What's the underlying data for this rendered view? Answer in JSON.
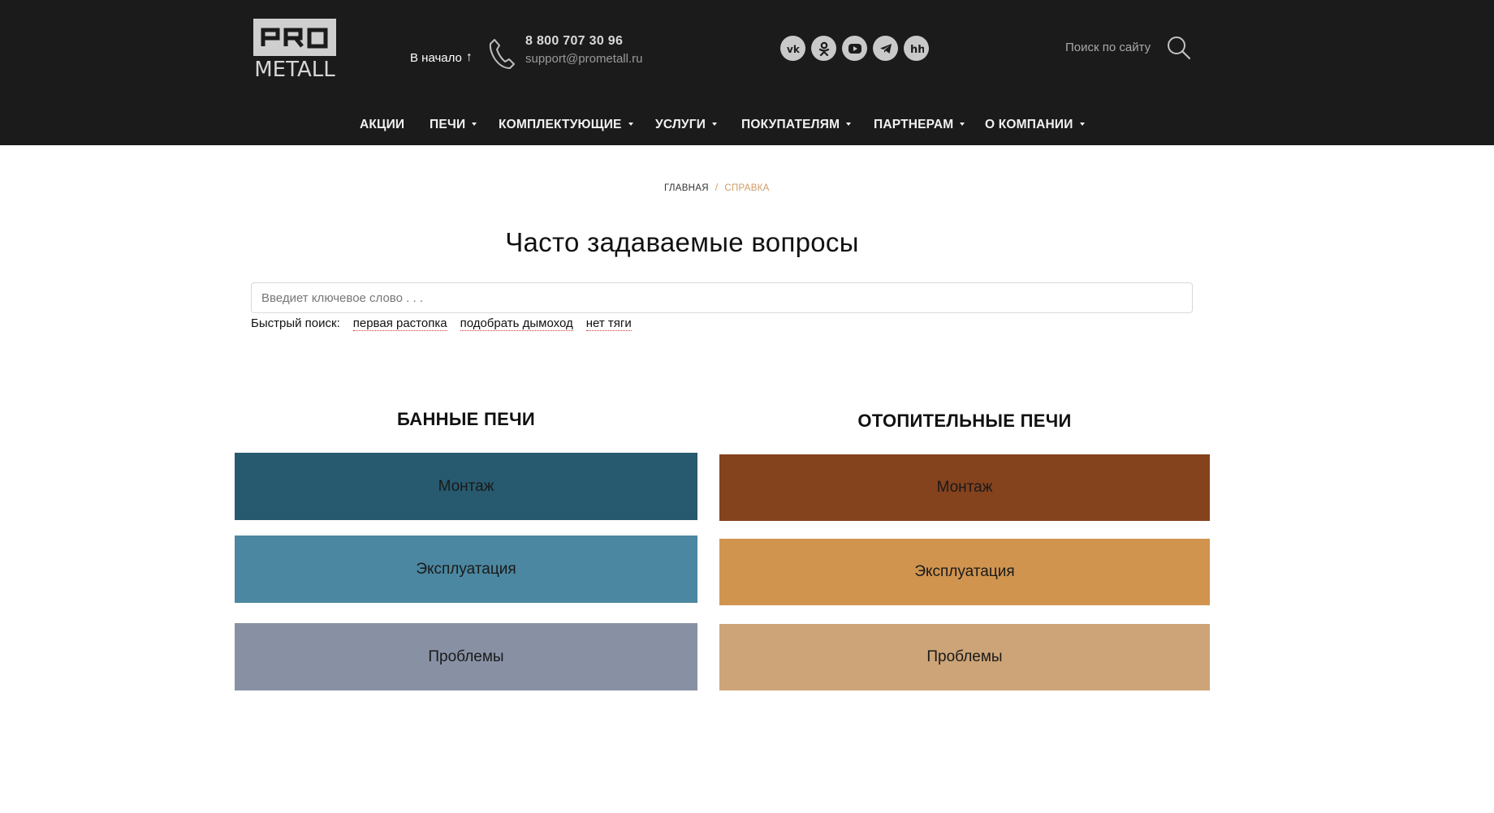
{
  "header": {
    "logo_text": "PRO METALL",
    "logo_bottom": "METALL",
    "to_top_label": "В начало",
    "phone": "8 800 707 30 96",
    "email": "support@prometall.ru",
    "socials": [
      "vk",
      "ok",
      "youtube",
      "telegram",
      "hh"
    ],
    "search_label": "Поиск по сайту"
  },
  "nav": [
    {
      "label": "АКЦИИ",
      "dropdown": false
    },
    {
      "label": "ПЕЧИ",
      "dropdown": true
    },
    {
      "label": "КОМПЛЕКТУЮЩИЕ",
      "dropdown": true
    },
    {
      "label": "УСЛУГИ",
      "dropdown": true
    },
    {
      "label": "ПОКУПАТЕЛЯМ",
      "dropdown": true
    },
    {
      "label": "ПАРТНЕРАМ",
      "dropdown": true
    },
    {
      "label": "О КОМПАНИИ",
      "dropdown": true
    }
  ],
  "breadcrumb": {
    "home": "ГЛАВНАЯ",
    "separator": "/",
    "current": "СПРАВКА"
  },
  "page_title": "Часто задаваемые вопросы",
  "search": {
    "placeholder": "Введиет ключевое слово . . .",
    "value": ""
  },
  "quick_search": {
    "label": "Быстрый поиск:",
    "links": [
      "первая растопка",
      "подобрать дымоход",
      "нет тяги"
    ]
  },
  "categories": {
    "bath": {
      "title": "БАННЫЕ ПЕЧИ",
      "tiles": [
        {
          "label": "Монтаж",
          "color": "#275a6f"
        },
        {
          "label": "Эксплуатация",
          "color": "#4b87a0"
        },
        {
          "label": "Проблемы",
          "color": "#8891a4"
        }
      ]
    },
    "heating": {
      "title": "ОТОПИТЕЛЬНЫЕ ПЕЧИ",
      "tiles": [
        {
          "label": "Монтаж",
          "color": "#84421d"
        },
        {
          "label": "Эксплуатация",
          "color": "#d0944f"
        },
        {
          "label": "Проблемы",
          "color": "#cda478"
        }
      ]
    }
  },
  "colors": {
    "header_bg": "#1b1b1b",
    "accent": "#cf9a66"
  }
}
